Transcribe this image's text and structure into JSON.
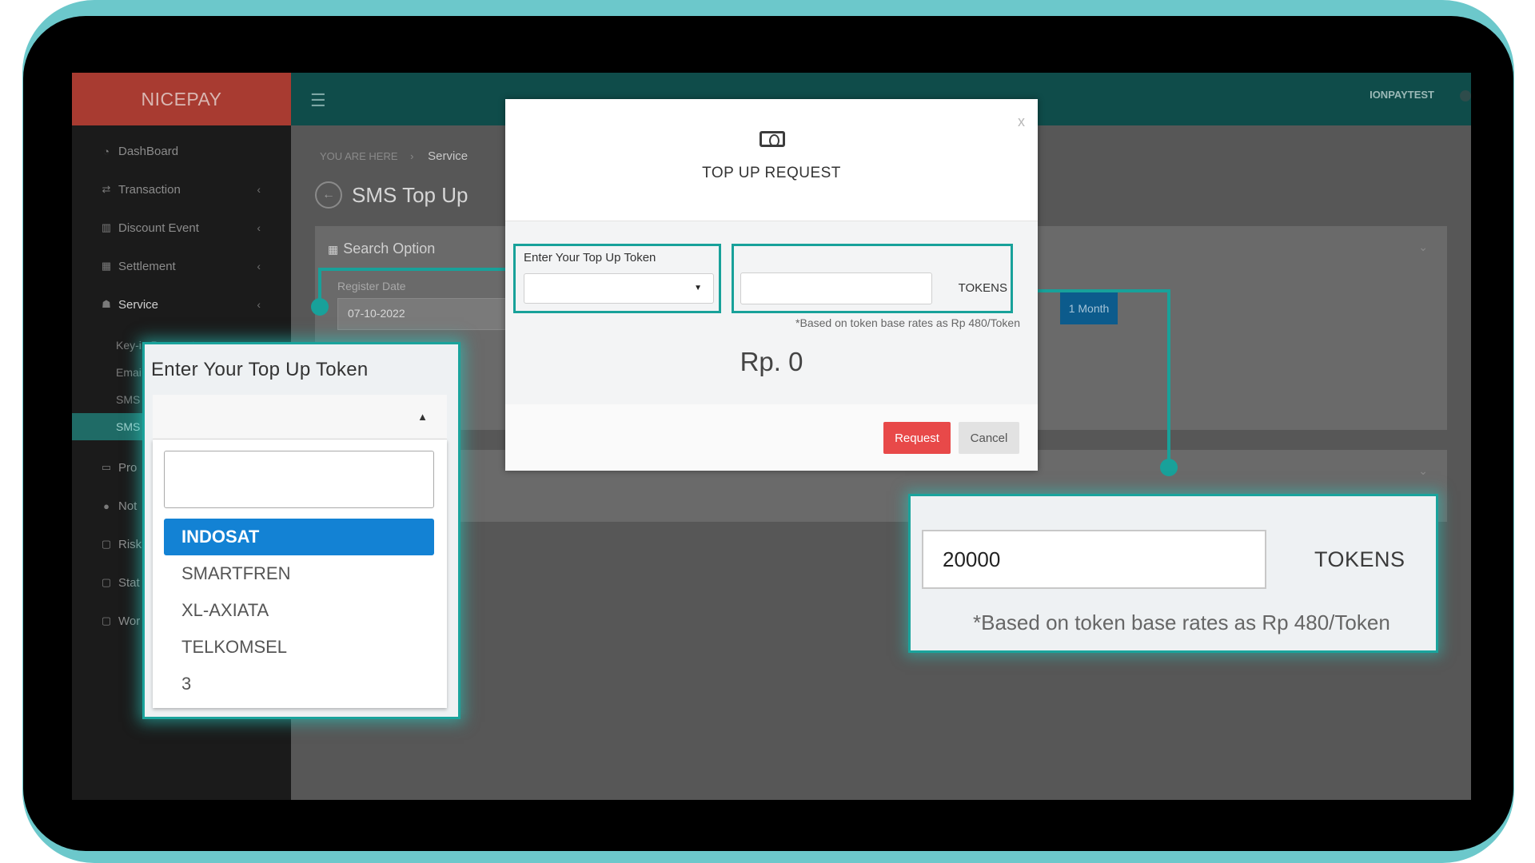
{
  "app": {
    "brand": "NICEPAY",
    "user": "IONPAYTEST"
  },
  "sidebar": {
    "items": [
      {
        "label": "DashBoard",
        "icon": "dashboard-icon"
      },
      {
        "label": "Transaction",
        "icon": "exchange-icon"
      },
      {
        "label": "Discount Event",
        "icon": "bar-chart-icon"
      },
      {
        "label": "Settlement",
        "icon": "calendar-icon"
      },
      {
        "label": "Service",
        "icon": "users-icon"
      }
    ],
    "sub_items": [
      "Key-in Payment",
      "Emai",
      "SMS",
      "SMS"
    ],
    "more_items": [
      "Pro",
      "Not",
      "Risk",
      "Stat",
      "Wor"
    ]
  },
  "breadcrumb": {
    "prefix": "YOU ARE HERE",
    "current": "Service"
  },
  "page": {
    "title": "SMS Top Up",
    "search_option": "Search Option",
    "register_label": "Register Date",
    "register_value": "07-10-2022",
    "month_button": "1 Month"
  },
  "modal": {
    "title": "TOP UP REQUEST",
    "close": "x",
    "token_label": "Enter Your Top Up Token",
    "amount_value": "",
    "tokens_label": "TOKENS",
    "rate_note": "*Based on token base rates as Rp 480/Token",
    "total": "Rp. 0",
    "request_button": "Request",
    "cancel_button": "Cancel"
  },
  "callout_dropdown": {
    "title": "Enter Your Top Up Token",
    "options": [
      "INDOSAT",
      "SMARTFREN",
      "XL-AXIATA",
      "TELKOMSEL",
      "3"
    ],
    "selected": "INDOSAT"
  },
  "callout_tokens": {
    "value": "20000",
    "tokens_label": "TOKENS",
    "rate_note": "*Based on token base rates as Rp 480/Token"
  },
  "colors": {
    "accent": "#18a19a",
    "brand": "#a83b31",
    "selected_option": "#1382d4",
    "request": "#e84949"
  }
}
